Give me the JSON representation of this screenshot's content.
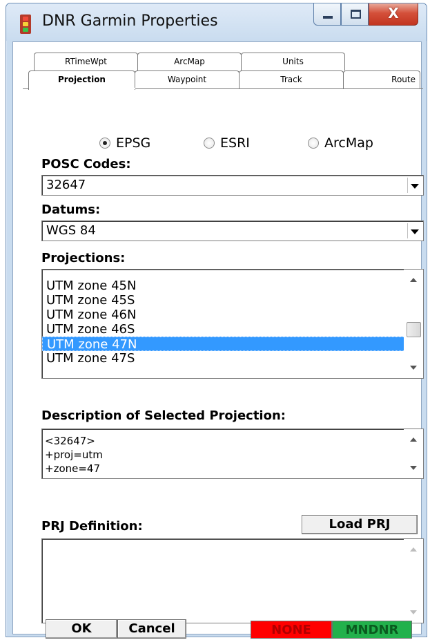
{
  "window": {
    "title": "DNR Garmin Properties"
  },
  "tabs": {
    "back_row": [
      "RTimeWpt",
      "ArcMap",
      "Units"
    ],
    "front_row": [
      "Projection",
      "Waypoint",
      "Track",
      "Route"
    ],
    "active": "Projection"
  },
  "radios": {
    "options": [
      "EPSG",
      "ESRI",
      "ArcMap"
    ],
    "selected": "EPSG"
  },
  "posc": {
    "label": "POSC Codes:",
    "value": "32647"
  },
  "datums": {
    "label": "Datums:",
    "value": "WGS 84"
  },
  "projections": {
    "label": "Projections:",
    "items": [
      "UTM zone 45N",
      "UTM zone 45S",
      "UTM zone 46N",
      "UTM zone 46S",
      "UTM zone 47N",
      "UTM zone 47S"
    ],
    "selected_index": 4
  },
  "description": {
    "label": "Description of Selected Projection:",
    "lines": [
      "<32647>",
      "+proj=utm",
      "+zone=47"
    ]
  },
  "prj": {
    "label": "PRJ Definition:",
    "load_button": "Load PRJ",
    "text": ""
  },
  "footer": {
    "ok": "OK",
    "cancel": "Cancel",
    "status_none": "NONE",
    "status_mndnr": "MNDNR",
    "status_none_color": "#ff0000",
    "status_mndnr_color": "#22b14c"
  },
  "icons": {
    "app": "traffic-light-icon",
    "minimize": "minimize-icon",
    "maximize": "maximize-icon",
    "close": "close-icon"
  }
}
